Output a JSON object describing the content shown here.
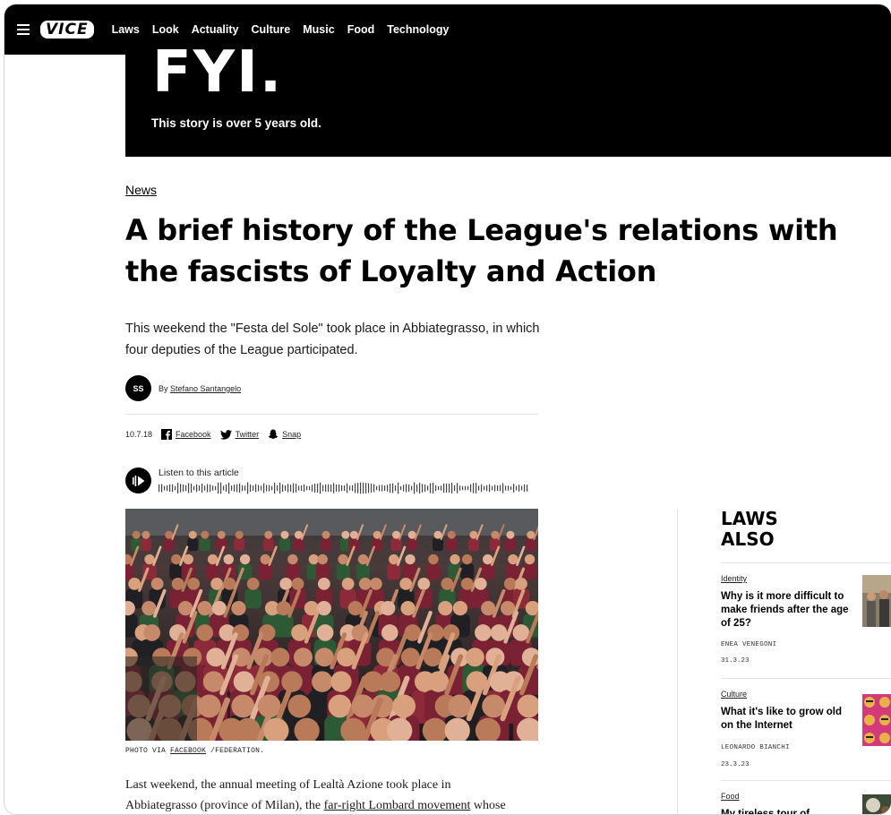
{
  "nav": {
    "logo": "VICE",
    "items": [
      "Laws",
      "Look",
      "Actuality",
      "Culture",
      "Music",
      "Food",
      "Technology"
    ]
  },
  "fyi": {
    "big": "FYI.",
    "sub": "This story is over 5 years old."
  },
  "article": {
    "category": "News",
    "headline": "A brief history of the League's relations with the fascists of Loyalty and Action",
    "dek": "This weekend the \"Festa del Sole\" took place in Abbiategrasso, in which four deputies of the League participated.",
    "byline": {
      "initials": "SS",
      "prefix": "By",
      "author": "Stefano Santangelo"
    },
    "date": "10.7.18",
    "share": {
      "facebook": "Facebook",
      "twitter": "Twitter",
      "snap": "Snap"
    },
    "audio_label": "Listen to this article",
    "caption": {
      "prefix": "PHOTO VIA",
      "link": "FACEBOOK",
      "suffix": "/FEDERATION."
    },
    "body": {
      "line1": "Last weekend, the annual meeting of Lealtà Azione took place in",
      "line2a": "Abbiategrasso (province of Milan), the",
      "link": "far-right Lombard movement",
      "line2b": "whose"
    }
  },
  "sidebar": {
    "title": "LAWS ALSO",
    "items": [
      {
        "category": "Identity",
        "title": "Why is it more difficult to make friends after the age of 25?",
        "author": "ENEA VENEGONI",
        "date": "31.3.23"
      },
      {
        "category": "Culture",
        "title": "What it's like to grow old on the Internet",
        "author": "LEONARDO BIANCHI",
        "date": "23.3.23"
      },
      {
        "category": "Food",
        "title": "My tireless tour of"
      }
    ]
  },
  "colors": {
    "nav_bg": "#000000",
    "banner_bg": "#000000",
    "shirt": "#7a2233"
  }
}
